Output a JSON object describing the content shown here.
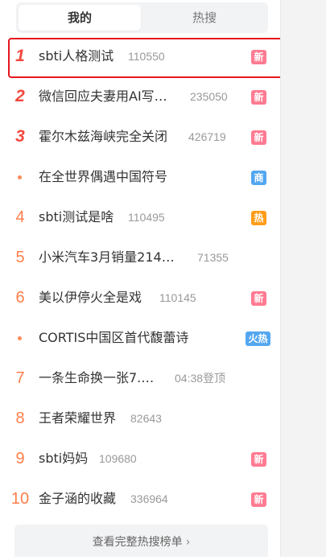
{
  "tabs": {
    "mine": "我的",
    "hot": "热搜"
  },
  "items": [
    {
      "rank": "1",
      "title": "sbti人格测试",
      "count": "110550",
      "badge": "新"
    },
    {
      "rank": "2",
      "title": "微信回应夫妻用AI写…",
      "count": "235050",
      "badge": "新"
    },
    {
      "rank": "3",
      "title": "霍尔木兹海峡完全关闭",
      "count": "426719",
      "badge": "新"
    },
    {
      "rank": "",
      "title": "在全世界偶遇中国符号",
      "count": "",
      "badge": "商"
    },
    {
      "rank": "4",
      "title": "sbti测试是啥",
      "count": "110495",
      "badge": "热"
    },
    {
      "rank": "5",
      "title": "小米汽车3月销量214…",
      "count": "71355",
      "badge": ""
    },
    {
      "rank": "6",
      "title": "美以伊停火全是戏",
      "count": "110145",
      "badge": "新"
    },
    {
      "rank": "",
      "title": "CORTIS中国区首代馥蕾诗",
      "count": "",
      "badge": "火热"
    },
    {
      "rank": "7",
      "title": "一条生命换一张7.…",
      "count": "04:38登顶",
      "badge": ""
    },
    {
      "rank": "8",
      "title": "王者荣耀世界",
      "count": "82643",
      "badge": ""
    },
    {
      "rank": "9",
      "title": "sbti妈妈",
      "count": "109680",
      "badge": "新"
    },
    {
      "rank": "10",
      "title": "金子涵的收藏",
      "count": "336964",
      "badge": "新"
    }
  ],
  "footer": {
    "label": "查看完整热搜榜单",
    "chevron": "›"
  },
  "colors": {
    "top_rank": "#f4483e",
    "rank": "#ff7e4a",
    "badge_new": "#ff7b92",
    "badge_ad": "#53a7f0",
    "badge_hot": "#ff9d19",
    "highlight_border": "#e5161d"
  },
  "icons": {
    "promoted_dot": "orange-dot-icon",
    "footer_chevron": "chevron-right-icon"
  }
}
